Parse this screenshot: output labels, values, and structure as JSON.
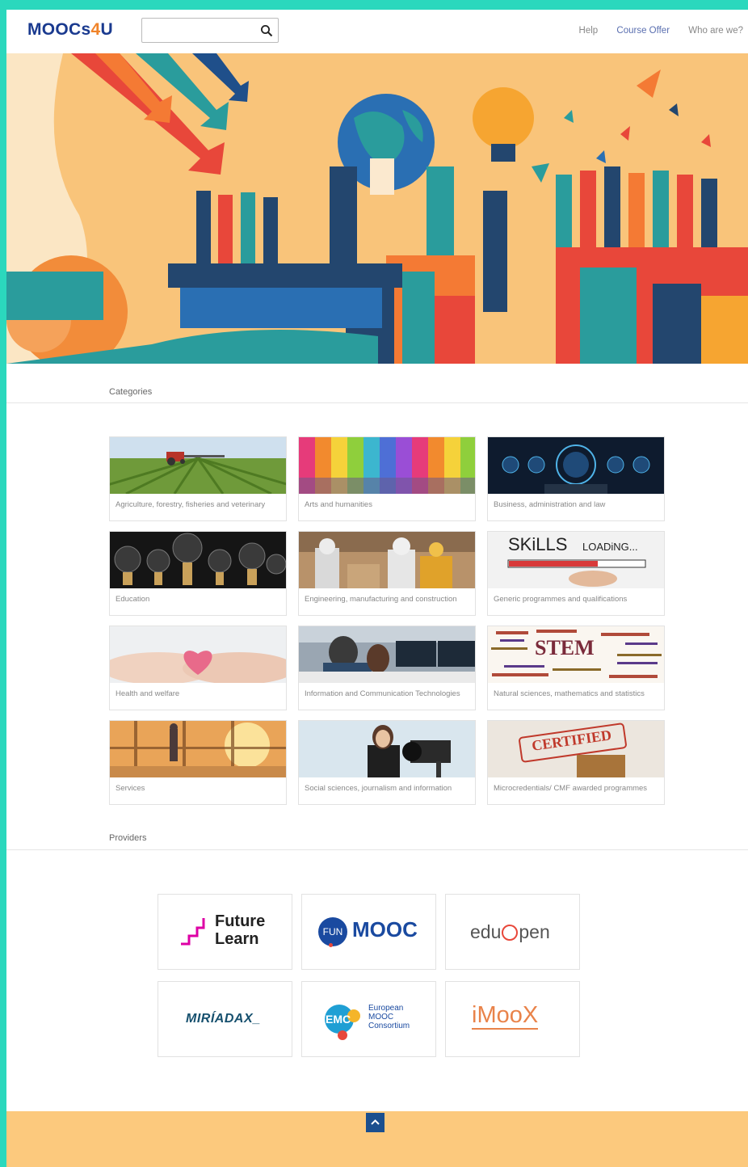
{
  "header": {
    "logo_prefix": "MOOCs",
    "logo_four": "4",
    "logo_suffix": "U",
    "search_placeholder": "",
    "nav": [
      "Help",
      "Course Offer",
      "Who are we?"
    ]
  },
  "categories_title": "Categories",
  "categories": [
    {
      "label": "Agriculture, forestry, fisheries and veterinary",
      "icon": "tractor-field-photo"
    },
    {
      "label": "Arts and humanities",
      "icon": "colored-pencils-photo"
    },
    {
      "label": "Business, administration and law",
      "icon": "justice-scale-photo"
    },
    {
      "label": "Education",
      "icon": "lightbulbs-photo"
    },
    {
      "label": "Engineering, manufacturing and construction",
      "icon": "robot-worker-photo"
    },
    {
      "label": "Generic programmes and qualifications",
      "icon": "skills-loading-photo"
    },
    {
      "label": "Health and welfare",
      "icon": "heart-hands-photo"
    },
    {
      "label": "Information and Communication Technologies",
      "icon": "computer-office-photo"
    },
    {
      "label": "Natural sciences, mathematics and statistics",
      "icon": "stem-wordcloud-photo"
    },
    {
      "label": "Services",
      "icon": "airport-traveler-photo"
    },
    {
      "label": "Social sciences, journalism and information",
      "icon": "journalist-camera-photo"
    },
    {
      "label": "Microcredentials/ CMF awarded programmes",
      "icon": "certified-stamp-photo"
    }
  ],
  "image_text": {
    "skills": "SKiLLS",
    "loading": "LOADiNG...",
    "stem": "STEM",
    "certified": "CERTIFIED"
  },
  "providers_title": "Providers",
  "providers": {
    "futurelearn": {
      "line1": "Future",
      "line2": "Learn"
    },
    "funmooc": {
      "badge": "FUN",
      "word": "MOOC"
    },
    "eduopen": {
      "text": "edu",
      "text2": "pen"
    },
    "miriadax": {
      "text": "MIRÍADAX_"
    },
    "emc": {
      "badge": "EMC",
      "line1": "European",
      "line2": "MOOC",
      "line3": "Consortium"
    },
    "imoox": {
      "text": "iMooX"
    }
  },
  "colors": {
    "teal_border": "#2bd8bd",
    "brand_blue": "#1a3a8f",
    "brand_orange": "#f0842a",
    "footer": "#fcc97d",
    "to_top": "#1b4f8e"
  }
}
